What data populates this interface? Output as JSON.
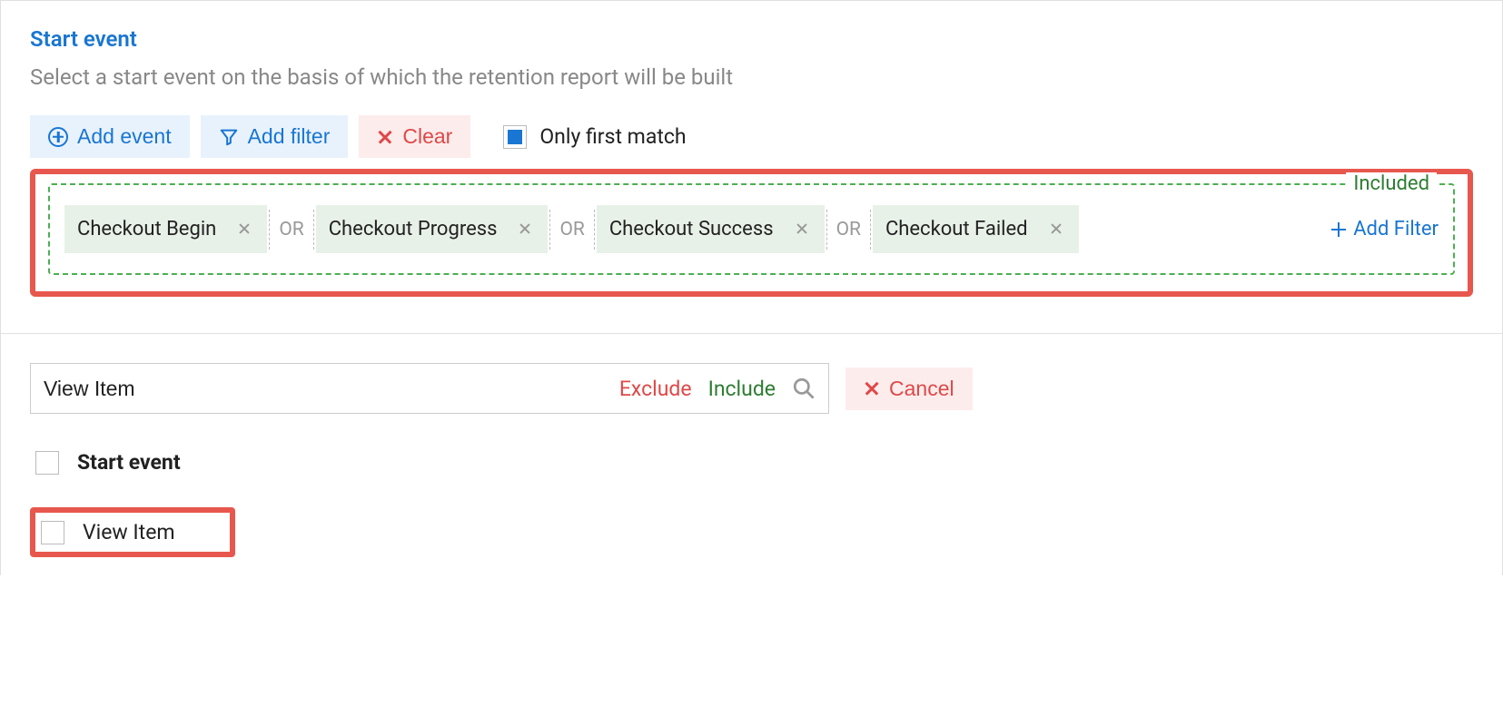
{
  "start": {
    "title": "Start event",
    "subtitle": "Select a start event on the basis of which the retention report will be built",
    "toolbar": {
      "add_event": "Add event",
      "add_filter": "Add filter",
      "clear": "Clear",
      "only_first_match": "Only first match"
    },
    "included": {
      "label": "Included",
      "events": [
        "Checkout Begin",
        "Checkout Progress",
        "Checkout Success",
        "Checkout Failed"
      ],
      "or": "OR",
      "add_filter_link": "Add Filter"
    }
  },
  "search": {
    "value": "View Item",
    "exclude": "Exclude",
    "include": "Include",
    "cancel": "Cancel"
  },
  "results": {
    "group_label": "Start event",
    "item": "View Item"
  }
}
